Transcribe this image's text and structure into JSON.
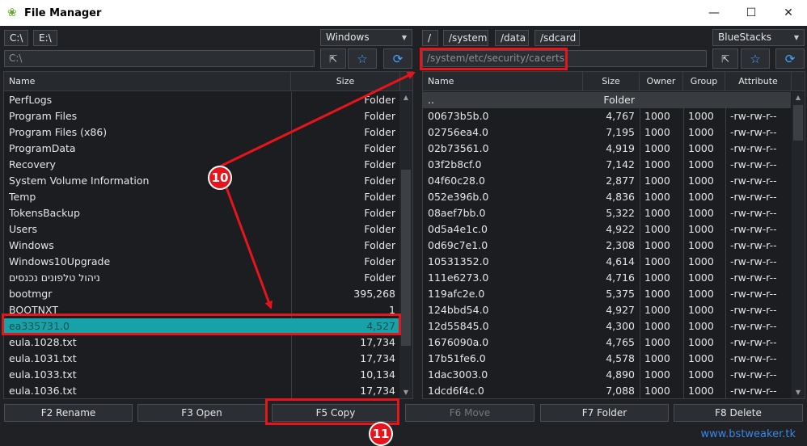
{
  "window": {
    "title": "File Manager",
    "minimize": "—",
    "maximize": "☐",
    "close": "✕"
  },
  "left": {
    "drives": [
      "C:\\",
      "E:\\"
    ],
    "location_combo": "Windows",
    "path_placeholder": "C:\\",
    "columns": {
      "name": "Name",
      "size": "Size"
    },
    "rows": [
      {
        "name": "PerfLogs",
        "size": "Folder"
      },
      {
        "name": "Program Files",
        "size": "Folder"
      },
      {
        "name": "Program Files (x86)",
        "size": "Folder"
      },
      {
        "name": "ProgramData",
        "size": "Folder"
      },
      {
        "name": "Recovery",
        "size": "Folder"
      },
      {
        "name": "System Volume Information",
        "size": "Folder"
      },
      {
        "name": "Temp",
        "size": "Folder"
      },
      {
        "name": "TokensBackup",
        "size": "Folder"
      },
      {
        "name": "Users",
        "size": "Folder"
      },
      {
        "name": "Windows",
        "size": "Folder"
      },
      {
        "name": "Windows10Upgrade",
        "size": "Folder"
      },
      {
        "name": "ניהול טלפונים נכנסים",
        "size": "Folder"
      },
      {
        "name": "bootmgr",
        "size": "395,268"
      },
      {
        "name": "BOOTNXT",
        "size": "1"
      },
      {
        "name": "ea335731.0",
        "size": "4,527"
      },
      {
        "name": "eula.1028.txt",
        "size": "17,734"
      },
      {
        "name": "eula.1031.txt",
        "size": "17,734"
      },
      {
        "name": "eula.1033.txt",
        "size": "10,134"
      },
      {
        "name": "eula.1036.txt",
        "size": "17,734"
      }
    ]
  },
  "right": {
    "paths": [
      "/",
      "/system",
      "/data",
      "/sdcard"
    ],
    "location_combo": "BlueStacks",
    "path_value": "/system/etc/security/cacerts",
    "columns": {
      "name": "Name",
      "size": "Size",
      "owner": "Owner",
      "group": "Group",
      "attribute": "Attribute"
    },
    "parent_row": {
      "name": "..",
      "size": "Folder"
    },
    "rows": [
      {
        "name": "00673b5b.0",
        "size": "4,767",
        "owner": "1000",
        "group": "1000",
        "attr": "-rw-rw-r--"
      },
      {
        "name": "02756ea4.0",
        "size": "7,195",
        "owner": "1000",
        "group": "1000",
        "attr": "-rw-rw-r--"
      },
      {
        "name": "02b73561.0",
        "size": "4,919",
        "owner": "1000",
        "group": "1000",
        "attr": "-rw-rw-r--"
      },
      {
        "name": "03f2b8cf.0",
        "size": "7,142",
        "owner": "1000",
        "group": "1000",
        "attr": "-rw-rw-r--"
      },
      {
        "name": "04f60c28.0",
        "size": "2,877",
        "owner": "1000",
        "group": "1000",
        "attr": "-rw-rw-r--"
      },
      {
        "name": "052e396b.0",
        "size": "4,836",
        "owner": "1000",
        "group": "1000",
        "attr": "-rw-rw-r--"
      },
      {
        "name": "08aef7bb.0",
        "size": "5,322",
        "owner": "1000",
        "group": "1000",
        "attr": "-rw-rw-r--"
      },
      {
        "name": "0d5a4e1c.0",
        "size": "4,922",
        "owner": "1000",
        "group": "1000",
        "attr": "-rw-rw-r--"
      },
      {
        "name": "0d69c7e1.0",
        "size": "2,308",
        "owner": "1000",
        "group": "1000",
        "attr": "-rw-rw-r--"
      },
      {
        "name": "10531352.0",
        "size": "4,614",
        "owner": "1000",
        "group": "1000",
        "attr": "-rw-rw-r--"
      },
      {
        "name": "111e6273.0",
        "size": "4,716",
        "owner": "1000",
        "group": "1000",
        "attr": "-rw-rw-r--"
      },
      {
        "name": "119afc2e.0",
        "size": "5,375",
        "owner": "1000",
        "group": "1000",
        "attr": "-rw-rw-r--"
      },
      {
        "name": "124bbd54.0",
        "size": "4,927",
        "owner": "1000",
        "group": "1000",
        "attr": "-rw-rw-r--"
      },
      {
        "name": "12d55845.0",
        "size": "4,300",
        "owner": "1000",
        "group": "1000",
        "attr": "-rw-rw-r--"
      },
      {
        "name": "1676090a.0",
        "size": "4,765",
        "owner": "1000",
        "group": "1000",
        "attr": "-rw-rw-r--"
      },
      {
        "name": "17b51fe6.0",
        "size": "4,578",
        "owner": "1000",
        "group": "1000",
        "attr": "-rw-rw-r--"
      },
      {
        "name": "1dac3003.0",
        "size": "4,890",
        "owner": "1000",
        "group": "1000",
        "attr": "-rw-rw-r--"
      },
      {
        "name": "1dcd6f4c.0",
        "size": "7,088",
        "owner": "1000",
        "group": "1000",
        "attr": "-rw-rw-r--"
      }
    ]
  },
  "function_buttons": [
    "F2 Rename",
    "F3 Open",
    "F5 Copy",
    "F6 Move",
    "F7 Folder",
    "F8 Delete"
  ],
  "annotations": {
    "badge_a": "10",
    "badge_b": "11"
  },
  "watermark": "www.bstweaker.tk",
  "colors": {
    "selection": "#17a2a8",
    "highlight": "#e8141c",
    "accent": "#4aa3ff"
  },
  "icons": {
    "app": "leaf-icon",
    "select": "select-cursor-icon",
    "favorite": "star-icon",
    "refresh": "refresh-icon"
  }
}
